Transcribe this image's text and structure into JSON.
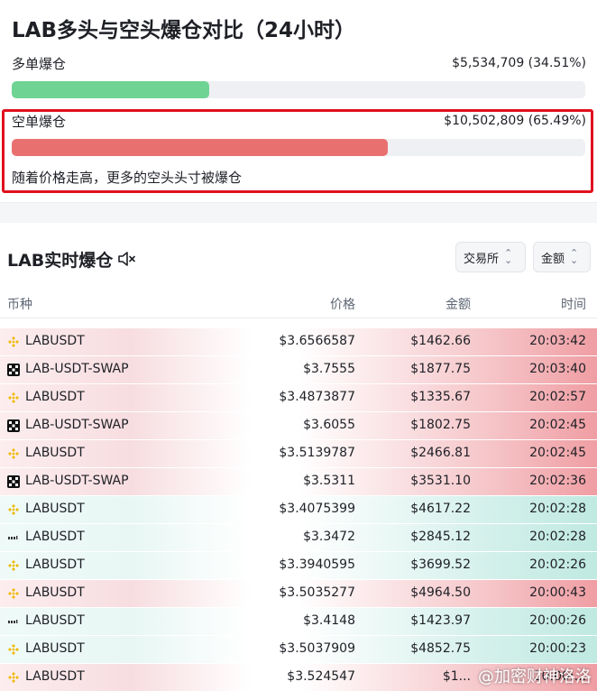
{
  "header": {
    "title": "LAB多头与空头爆仓对比（24小时）"
  },
  "long_liq": {
    "label": "多单爆仓",
    "value": "$5,534,709 (34.51%)",
    "fraction": 0.3451,
    "color": "#6fd394"
  },
  "short_liq": {
    "label": "空单爆仓",
    "value": "$10,502,809 (65.49%)",
    "fraction": 0.6549,
    "color": "#e8716f"
  },
  "note": "随着价格走高，更多的空头头寸被爆仓",
  "section": {
    "title": "LAB实时爆仓",
    "mute_icon": "speaker-muted-icon",
    "filter_exchange": "交易所",
    "filter_amount": "金额"
  },
  "table": {
    "headers": [
      "币种",
      "价格",
      "金额",
      "时间"
    ],
    "rows": [
      {
        "exchange": "binance",
        "symbol": "LABUSDT",
        "price": "$3.6566587",
        "amount": "$1462.66",
        "time": "20:03:42",
        "side": "long"
      },
      {
        "exchange": "okx",
        "symbol": "LAB-USDT-SWAP",
        "price": "$3.7555",
        "amount": "$1877.75",
        "time": "20:03:40",
        "side": "long"
      },
      {
        "exchange": "binance",
        "symbol": "LABUSDT",
        "price": "$3.4873877",
        "amount": "$1335.67",
        "time": "20:02:57",
        "side": "long"
      },
      {
        "exchange": "okx",
        "symbol": "LAB-USDT-SWAP",
        "price": "$3.6055",
        "amount": "$1802.75",
        "time": "20:02:45",
        "side": "long"
      },
      {
        "exchange": "binance",
        "symbol": "LABUSDT",
        "price": "$3.5139787",
        "amount": "$2466.81",
        "time": "20:02:45",
        "side": "long"
      },
      {
        "exchange": "okx",
        "symbol": "LAB-USDT-SWAP",
        "price": "$3.5311",
        "amount": "$3531.10",
        "time": "20:02:36",
        "side": "long"
      },
      {
        "exchange": "binance",
        "symbol": "LABUSDT",
        "price": "$3.4075399",
        "amount": "$4617.22",
        "time": "20:02:28",
        "side": "short"
      },
      {
        "exchange": "bybit",
        "symbol": "LABUSDT",
        "price": "$3.3472",
        "amount": "$2845.12",
        "time": "20:02:28",
        "side": "short"
      },
      {
        "exchange": "binance",
        "symbol": "LABUSDT",
        "price": "$3.3940595",
        "amount": "$3699.52",
        "time": "20:02:26",
        "side": "short"
      },
      {
        "exchange": "binance",
        "symbol": "LABUSDT",
        "price": "$3.5035277",
        "amount": "$4964.50",
        "time": "20:00:43",
        "side": "long"
      },
      {
        "exchange": "bybit",
        "symbol": "LABUSDT",
        "price": "$3.4148",
        "amount": "$1423.97",
        "time": "20:00:26",
        "side": "short"
      },
      {
        "exchange": "binance",
        "symbol": "LABUSDT",
        "price": "$3.5037909",
        "amount": "$4852.75",
        "time": "20:00:23",
        "side": "short"
      },
      {
        "exchange": "binance",
        "symbol": "LABUSDT",
        "price": "$3.524547",
        "amount": "$1...",
        "time": "20:00:...",
        "side": "long"
      }
    ]
  },
  "watermark": "@加密财神洛洛"
}
